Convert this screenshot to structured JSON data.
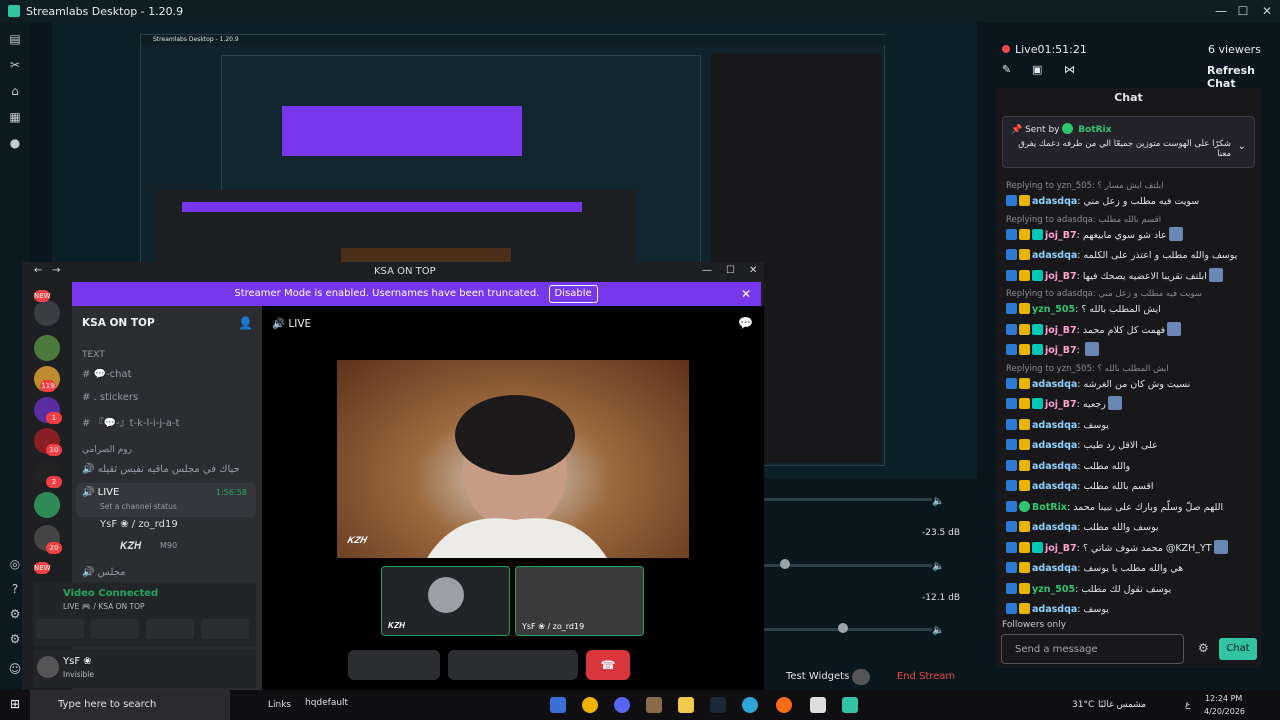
{
  "window": {
    "title": "Streamlabs Desktop - 1.20.9",
    "min": "—",
    "max": "☐",
    "close": "✕"
  },
  "stream": {
    "live_label": "Live01:51:21",
    "viewers": "6 viewers",
    "refresh_chat": "Refresh Chat",
    "chat_title": "Chat",
    "followers_only": "Followers only",
    "send_placeholder": "Send a message",
    "chat_button": "Chat",
    "test_widgets": "Test Widgets",
    "end_stream": "End Stream"
  },
  "pinned": {
    "sent_by_prefix": "Sent by",
    "sender": "BotRix",
    "message": "شكرًا على الهوست متوزين جميعًا الي من طرفه دعمك يفرق معنا"
  },
  "chat_messages": [
    {
      "reply": "Replying to yzn_505: ابلتف ايش مسار ؟"
    },
    {
      "user": "adasdqa",
      "text": "سويت فيه مطلب و زعل مني"
    },
    {
      "reply": "Replying to adasdqa: اقسم بالله مطلب"
    },
    {
      "user": "joj_B7",
      "text": "عاد شو سوي مابيغهم"
    },
    {
      "user": "adasdqa",
      "text": "يوسف والله مطلب و اعتذر على الكلمه"
    },
    {
      "user": "joj_B7",
      "text": "ابلتف تقريبا الاعضيه يصحك فيها"
    },
    {
      "reply": "Replying to adasdqa: سويت فيه مطلب و زعل مني"
    },
    {
      "user": "yzn_505",
      "text": "ايش المطلب بالله ؟"
    },
    {
      "user": "joj_B7",
      "text": "فهمت كل كلام محمد"
    },
    {
      "user": "joj_B7",
      "text": ""
    },
    {
      "reply": "Replying to yzn_505: ايش المطلب بالله ؟"
    },
    {
      "user": "adasdqa",
      "text": "نسيت وش كان من الغرشه"
    },
    {
      "user": "joj_B7",
      "text": "رجعيه"
    },
    {
      "user": "adasdqa",
      "text": "يوسف"
    },
    {
      "user": "adasdqa",
      "text": "على الاقل رد طيب"
    },
    {
      "user": "adasdqa",
      "text": "والله مطلب"
    },
    {
      "user": "adasdqa",
      "text": "اقسم بالله مطلب"
    },
    {
      "user": "BotRix",
      "text": "اللهم صلّ وسلّم وبارك على نبينا محمد"
    },
    {
      "user": "adasdqa",
      "text": "يوسف والله مطلب"
    },
    {
      "user": "joj_B7",
      "text": "محمد شوف شاتي ؟ @KZH_YT"
    },
    {
      "user": "adasdqa",
      "text": "هي والله مطلب يا يوسف"
    },
    {
      "user": "yzn_505",
      "text": "يوسف تقول لك مطلب"
    },
    {
      "user": "adasdqa",
      "text": "يوسف"
    }
  ],
  "mixer": {
    "db1": "-23.5 dB",
    "db2": "-12.1 dB"
  },
  "discord": {
    "window_title": "KSA ON TOP",
    "streamer_notice": "Streamer Mode is enabled. Usernames have been truncated.",
    "disable": "Disable",
    "server_name": "KSA ON TOP",
    "text_category": "TEXT",
    "channels": [
      "💬-chat",
      ". stickers",
      "『💬-』t-k-l-i-j-a-t"
    ],
    "voice_category": "روم الصرامي",
    "voice_channel_welcome": "حياك في مجلس ماقيه تفيس ثقيله",
    "live_channel": "LIVE",
    "live_timer": "1:56:58",
    "channel_status": "Set a channel status",
    "member1": "YsF ❀ / zo_rd19",
    "member2": "𝑲𝒁𝑯",
    "member2_tag": "M90",
    "majlis": "مجلس",
    "video_connected": "Video Connected",
    "video_sub": "LIVE 🎮 / KSA ON TOP",
    "user_name": "YsF ❀",
    "user_status": "Invisible",
    "call_channel": "LIVE",
    "video_tag": "𝑲𝒁𝑯",
    "tile1": "𝑲𝒁𝑯",
    "tile2": "YsF ❀ / zo_rd19",
    "server_badges": [
      "NEW",
      "119",
      "1",
      "10",
      "2",
      "20",
      "NEW"
    ]
  },
  "taskbar": {
    "search": "Type here to search",
    "links": "Links",
    "file": "hqdefault",
    "weather": "31°C",
    "weather_text": "مشمس غالبًا",
    "lang": "ع",
    "time": "12:24 PM",
    "date": "4/20/2026"
  }
}
